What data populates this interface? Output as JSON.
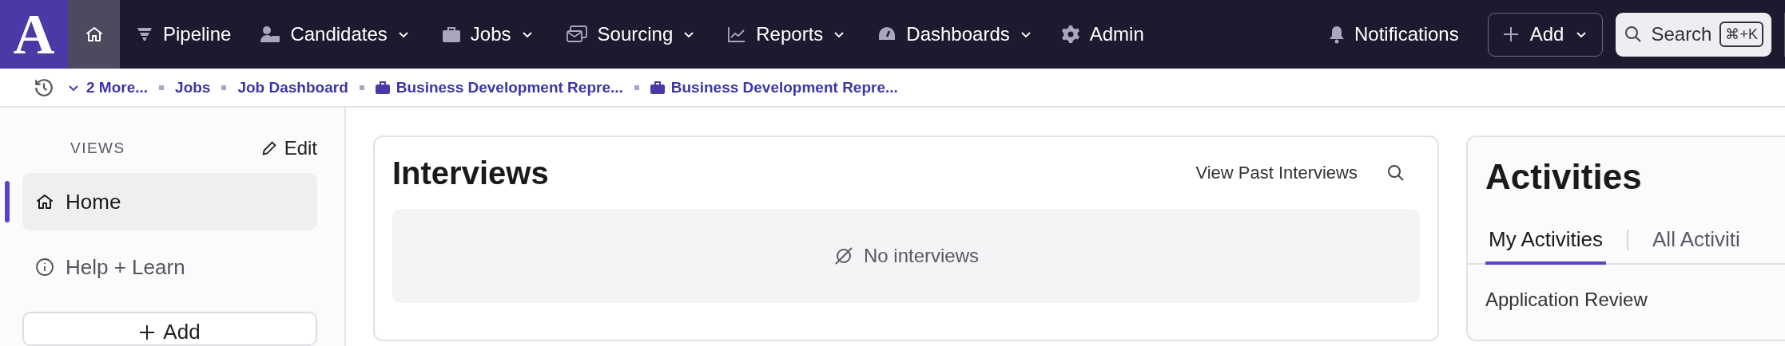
{
  "logo": {
    "letter": "A"
  },
  "nav": {
    "items": [
      {
        "label": "Pipeline",
        "menu": false,
        "selected": false
      },
      {
        "label": "Candidates",
        "menu": true,
        "selected": false
      },
      {
        "label": "Jobs",
        "menu": true,
        "selected": false
      },
      {
        "label": "Sourcing",
        "menu": true,
        "selected": false
      },
      {
        "label": "Reports",
        "menu": true,
        "selected": false
      },
      {
        "label": "Dashboards",
        "menu": true,
        "selected": false
      },
      {
        "label": "Admin",
        "menu": false,
        "selected": false
      }
    ],
    "home_selected": true,
    "notifications": "Notifications",
    "add": "Add",
    "search": {
      "placeholder": "Search",
      "shortcut": "⌘+K"
    }
  },
  "breadcrumbs": [
    {
      "label": "2 More...",
      "kind": "more"
    },
    {
      "label": "Jobs",
      "kind": "link"
    },
    {
      "label": "Job Dashboard",
      "kind": "link"
    },
    {
      "label": "Business Development Repre...",
      "kind": "job"
    },
    {
      "label": "Business Development Repre...",
      "kind": "job"
    }
  ],
  "sidebar": {
    "heading": "VIEWS",
    "edit": "Edit",
    "items": [
      {
        "label": "Home",
        "kind": "home",
        "selected": true
      },
      {
        "label": "Help + Learn",
        "kind": "help",
        "selected": false
      }
    ],
    "add": "Add"
  },
  "interviews": {
    "title": "Interviews",
    "link": "View Past Interviews",
    "empty": "No interviews"
  },
  "activities": {
    "title": "Activities",
    "tabs": [
      {
        "label": "My Activities",
        "selected": true
      },
      {
        "label": "All Activiti",
        "selected": false
      }
    ],
    "section": "Application Review"
  }
}
